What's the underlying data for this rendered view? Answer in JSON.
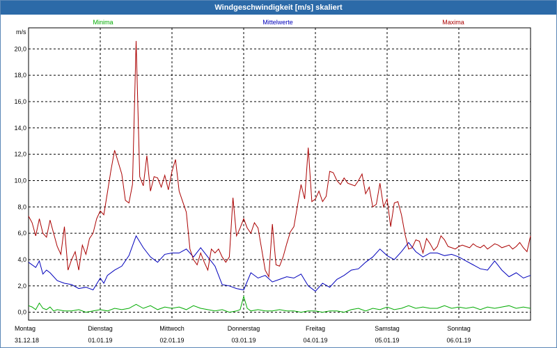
{
  "window": {
    "title": "Windgeschwindigkeit [m/s] skaliert"
  },
  "chart_data": {
    "type": "line",
    "title": "Windgeschwindigkeit [m/s] skaliert",
    "ylabel": "m/s",
    "ylim": [
      -0.6,
      21.6
    ],
    "xlim": [
      0,
      7
    ],
    "yticks": [
      0.0,
      2.0,
      4.0,
      6.0,
      8.0,
      10.0,
      12.0,
      14.0,
      16.0,
      18.0,
      20.0
    ],
    "ytick_labels": [
      "0,0",
      "2,0",
      "4,0",
      "6,0",
      "8,0",
      "10,0",
      "12,0",
      "14,0",
      "16,0",
      "18,0",
      "20,0"
    ],
    "xticks": [
      {
        "day": "Montag",
        "date": "31.12.18"
      },
      {
        "day": "Dienstag",
        "date": "01.01.19"
      },
      {
        "day": "Mittwoch",
        "date": "02.01.19"
      },
      {
        "day": "Donnerstag",
        "date": "03.01.19"
      },
      {
        "day": "Freitag",
        "date": "04.01.19"
      },
      {
        "day": "Samstag",
        "date": "05.01.19"
      },
      {
        "day": "Sonntag",
        "date": "06.01.19"
      }
    ],
    "grid": true,
    "legend_position": "top",
    "series": [
      {
        "name": "Minima",
        "color": "#00aa00",
        "x": [
          0,
          0.05,
          0.1,
          0.15,
          0.2,
          0.25,
          0.3,
          0.35,
          0.4,
          0.5,
          0.6,
          0.7,
          0.8,
          0.9,
          1.0,
          1.1,
          1.2,
          1.3,
          1.4,
          1.5,
          1.6,
          1.7,
          1.8,
          1.9,
          2.0,
          2.1,
          2.2,
          2.3,
          2.4,
          2.5,
          2.6,
          2.7,
          2.8,
          2.9,
          2.95,
          3.0,
          3.05,
          3.1,
          3.2,
          3.3,
          3.4,
          3.5,
          3.6,
          3.7,
          3.8,
          3.9,
          4.0,
          4.1,
          4.2,
          4.3,
          4.4,
          4.5,
          4.6,
          4.7,
          4.8,
          4.9,
          5.0,
          5.1,
          5.2,
          5.3,
          5.4,
          5.5,
          5.6,
          5.7,
          5.8,
          5.9,
          6.0,
          6.1,
          6.2,
          6.3,
          6.4,
          6.5,
          6.6,
          6.7,
          6.8,
          6.9,
          7.0
        ],
        "values": [
          0.5,
          0.4,
          0.2,
          0.7,
          0.3,
          0.2,
          0.4,
          0.1,
          0.2,
          0.1,
          0.1,
          0.2,
          0.0,
          0.1,
          0.2,
          0.1,
          0.3,
          0.2,
          0.3,
          0.6,
          0.3,
          0.5,
          0.2,
          0.4,
          0.3,
          0.4,
          0.2,
          0.5,
          0.3,
          0.2,
          0.1,
          0.2,
          0.0,
          0.1,
          0.2,
          1.2,
          0.3,
          0.1,
          0.2,
          0.1,
          0.1,
          0.2,
          0.1,
          0.1,
          0.0,
          0.1,
          0.1,
          0.0,
          0.1,
          0.1,
          0.0,
          0.2,
          0.3,
          0.1,
          0.3,
          0.2,
          0.4,
          0.2,
          0.3,
          0.5,
          0.3,
          0.4,
          0.3,
          0.3,
          0.5,
          0.3,
          0.4,
          0.3,
          0.4,
          0.2,
          0.4,
          0.3,
          0.4,
          0.5,
          0.3,
          0.4,
          0.3
        ]
      },
      {
        "name": "Mittelwerte",
        "color": "#0000bb",
        "x": [
          0,
          0.1,
          0.15,
          0.2,
          0.25,
          0.3,
          0.4,
          0.5,
          0.6,
          0.7,
          0.8,
          0.9,
          1.0,
          1.05,
          1.1,
          1.2,
          1.3,
          1.4,
          1.5,
          1.6,
          1.7,
          1.8,
          1.9,
          2.0,
          2.1,
          2.2,
          2.3,
          2.4,
          2.5,
          2.6,
          2.7,
          2.8,
          2.9,
          3.0,
          3.1,
          3.2,
          3.3,
          3.4,
          3.5,
          3.6,
          3.7,
          3.8,
          3.9,
          4.0,
          4.1,
          4.2,
          4.3,
          4.4,
          4.5,
          4.6,
          4.7,
          4.8,
          4.9,
          5.0,
          5.1,
          5.2,
          5.3,
          5.4,
          5.5,
          5.6,
          5.7,
          5.8,
          5.9,
          6.0,
          6.1,
          6.2,
          6.3,
          6.4,
          6.5,
          6.6,
          6.7,
          6.8,
          6.9,
          7.0
        ],
        "values": [
          3.8,
          3.4,
          3.9,
          2.9,
          3.2,
          3.0,
          2.4,
          2.2,
          2.1,
          1.8,
          1.9,
          1.7,
          2.6,
          2.2,
          2.8,
          3.2,
          3.5,
          4.3,
          5.8,
          4.9,
          4.2,
          3.8,
          4.4,
          4.5,
          4.5,
          4.8,
          4.2,
          4.9,
          4.2,
          3.5,
          2.1,
          2.0,
          1.8,
          1.7,
          3.0,
          2.6,
          2.8,
          2.3,
          2.5,
          2.7,
          2.6,
          2.9,
          2.0,
          1.6,
          2.2,
          1.9,
          2.5,
          2.8,
          3.2,
          3.3,
          3.8,
          4.2,
          4.8,
          4.3,
          4.0,
          4.6,
          5.3,
          4.6,
          4.2,
          4.5,
          4.5,
          4.3,
          4.4,
          4.2,
          3.9,
          3.6,
          3.3,
          3.2,
          3.9,
          3.2,
          2.7,
          3.0,
          2.6,
          2.8
        ]
      },
      {
        "name": "Maxima",
        "color": "#aa0000",
        "x": [
          0,
          0.05,
          0.1,
          0.15,
          0.2,
          0.25,
          0.3,
          0.35,
          0.4,
          0.45,
          0.5,
          0.55,
          0.6,
          0.65,
          0.7,
          0.75,
          0.8,
          0.85,
          0.9,
          0.95,
          1.0,
          1.05,
          1.1,
          1.15,
          1.2,
          1.25,
          1.3,
          1.35,
          1.4,
          1.45,
          1.5,
          1.55,
          1.6,
          1.65,
          1.7,
          1.75,
          1.8,
          1.85,
          1.9,
          1.95,
          2.0,
          2.05,
          2.1,
          2.15,
          2.2,
          2.25,
          2.3,
          2.35,
          2.4,
          2.45,
          2.5,
          2.55,
          2.6,
          2.65,
          2.7,
          2.75,
          2.8,
          2.85,
          2.9,
          2.95,
          3.0,
          3.05,
          3.1,
          3.15,
          3.2,
          3.25,
          3.3,
          3.35,
          3.4,
          3.45,
          3.5,
          3.55,
          3.6,
          3.65,
          3.7,
          3.75,
          3.8,
          3.85,
          3.9,
          3.95,
          4.0,
          4.05,
          4.1,
          4.15,
          4.2,
          4.25,
          4.3,
          4.35,
          4.4,
          4.45,
          4.5,
          4.55,
          4.6,
          4.65,
          4.7,
          4.75,
          4.8,
          4.85,
          4.9,
          4.95,
          5.0,
          5.05,
          5.1,
          5.15,
          5.2,
          5.25,
          5.3,
          5.35,
          5.4,
          5.45,
          5.5,
          5.55,
          5.6,
          5.65,
          5.7,
          5.75,
          5.8,
          5.85,
          5.9,
          5.95,
          6.0,
          6.05,
          6.1,
          6.15,
          6.2,
          6.25,
          6.3,
          6.35,
          6.4,
          6.45,
          6.5,
          6.55,
          6.6,
          6.65,
          6.7,
          6.75,
          6.8,
          6.85,
          6.9,
          6.95,
          7.0
        ],
        "values": [
          7.3,
          6.8,
          5.8,
          7.1,
          6.0,
          5.7,
          7.0,
          6.0,
          5.0,
          4.4,
          6.5,
          3.2,
          4.0,
          4.6,
          3.2,
          5.1,
          4.4,
          5.6,
          6.0,
          7.1,
          7.7,
          7.4,
          9.1,
          10.8,
          12.3,
          11.4,
          10.5,
          8.5,
          8.3,
          9.7,
          20.6,
          10.3,
          9.6,
          11.9,
          9.2,
          10.3,
          10.2,
          9.5,
          10.4,
          9.3,
          10.7,
          11.6,
          9.2,
          8.4,
          7.6,
          4.8,
          4.0,
          3.6,
          4.5,
          3.8,
          3.2,
          4.8,
          4.5,
          4.8,
          4.2,
          3.8,
          4.2,
          8.7,
          5.8,
          6.4,
          7.1,
          6.4,
          6.0,
          6.8,
          6.4,
          4.8,
          3.2,
          2.7,
          6.7,
          3.6,
          3.5,
          4.2,
          5.2,
          6.1,
          6.5,
          8.1,
          9.7,
          8.6,
          12.5,
          8.4,
          8.6,
          9.2,
          8.4,
          8.8,
          10.7,
          10.6,
          10.0,
          9.7,
          10.2,
          9.8,
          9.7,
          9.6,
          10.0,
          10.5,
          9.0,
          9.5,
          8.0,
          8.2,
          9.8,
          8.0,
          8.6,
          6.5,
          8.3,
          8.4,
          7.4,
          5.9,
          4.8,
          4.9,
          5.5,
          5.4,
          4.5,
          5.6,
          5.2,
          4.7,
          5.0,
          5.8,
          5.5,
          5.0,
          4.9,
          4.8,
          5.0,
          5.1,
          5.0,
          4.9,
          5.2,
          5.0,
          4.9,
          5.1,
          4.8,
          5.0,
          5.2,
          5.1,
          4.9,
          5.0,
          5.1,
          4.8,
          5.0,
          5.3,
          4.9,
          4.6,
          5.8
        ]
      }
    ]
  }
}
